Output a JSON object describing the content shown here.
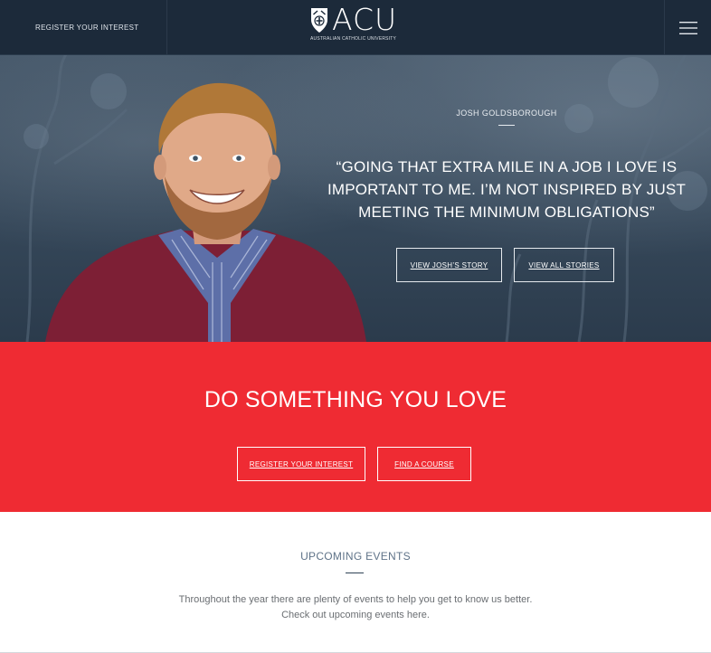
{
  "header": {
    "register_link": "REGISTER YOUR INTEREST",
    "logo_wordmark": "ACU",
    "logo_subline": "AUSTRALIAN CATHOLIC UNIVERSITY",
    "menu_icon": "hamburger-menu-icon",
    "background_color": "#1c2a3a"
  },
  "hero": {
    "name": "JOSH GOLDSBOROUGH",
    "quote_lines": [
      "“GOING THAT EXTRA MILE IN A JOB I LOVE IS",
      "IMPORTANT TO ME. I’M NOT INSPIRED BY JUST",
      "MEETING THE MINIMUM OBLIGATIONS”"
    ],
    "buttons": {
      "view_story": "VIEW JOSH’S STORY",
      "view_all": "VIEW ALL STORIES"
    }
  },
  "cta": {
    "headline": "DO SOMETHING YOU LOVE",
    "buttons": {
      "register": "REGISTER YOUR INTEREST",
      "find_course": "FIND A COURSE"
    },
    "background_color": "#ef2b33"
  },
  "events": {
    "title": "UPCOMING EVENTS",
    "description_lines": [
      "Throughout the year there are plenty of events to help you get to know us better.",
      "Check out upcoming events here."
    ]
  }
}
